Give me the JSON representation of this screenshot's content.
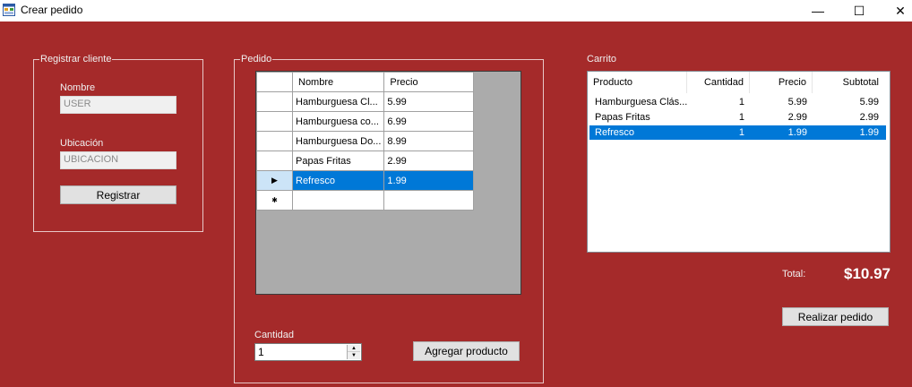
{
  "window": {
    "title": "Crear pedido",
    "icon": "form-icon",
    "minimize_glyph": "—",
    "maximize_glyph": "☐",
    "close_glyph": "✕"
  },
  "colors": {
    "background": "#a52a2a",
    "selection": "#0078d7"
  },
  "registrar_cliente": {
    "title": "Registrar cliente",
    "nombre_label": "Nombre",
    "nombre_value": "USER",
    "ubicacion_label": "Ubicación",
    "ubicacion_value": "UBICACION",
    "registrar_button": "Registrar"
  },
  "pedido": {
    "title": "Pedido",
    "grid": {
      "columns": [
        "Nombre",
        "Precio"
      ],
      "rows": [
        {
          "nombre": "Hamburguesa Cl...",
          "precio": "5.99"
        },
        {
          "nombre": "Hamburguesa co...",
          "precio": "6.99"
        },
        {
          "nombre": "Hamburguesa Do...",
          "precio": "8.99"
        },
        {
          "nombre": "Papas Fritas",
          "precio": "2.99"
        },
        {
          "nombre": "Refresco",
          "precio": "1.99"
        }
      ],
      "selected_row_marker": "▶",
      "new_row_marker": "✱"
    },
    "cantidad_label": "Cantidad",
    "cantidad_value": "1",
    "agregar_button": "Agregar producto"
  },
  "carrito": {
    "title": "Carrito",
    "columns": [
      "Producto",
      "Cantidad",
      "Precio",
      "Subtotal"
    ],
    "rows": [
      {
        "producto": "Hamburguesa Clás...",
        "cantidad": "1",
        "precio": "5.99",
        "subtotal": "5.99"
      },
      {
        "producto": "Papas Fritas",
        "cantidad": "1",
        "precio": "2.99",
        "subtotal": "2.99"
      },
      {
        "producto": "Refresco",
        "cantidad": "1",
        "precio": "1.99",
        "subtotal": "1.99"
      }
    ],
    "selected_row": 2
  },
  "total": {
    "label": "Total:",
    "value": "$10.97"
  },
  "realizar_button": "Realizar pedido"
}
